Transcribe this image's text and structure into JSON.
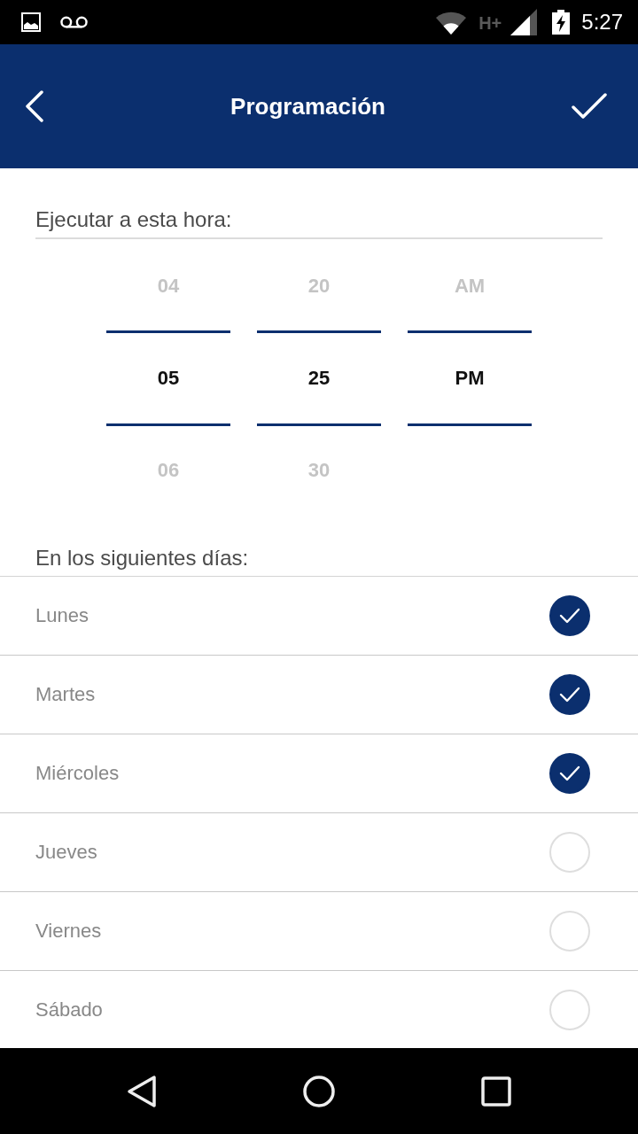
{
  "status_bar": {
    "network": "H+",
    "time": "5:27"
  },
  "app_bar": {
    "title": "Programación"
  },
  "time_section": {
    "label": "Ejecutar a esta hora:"
  },
  "picker": {
    "columns": [
      {
        "options": [
          {
            "label": "04",
            "selected": false
          },
          {
            "label": "05",
            "selected": true
          },
          {
            "label": "06",
            "selected": false
          }
        ]
      },
      {
        "options": [
          {
            "label": "20",
            "selected": false
          },
          {
            "label": "25",
            "selected": true
          },
          {
            "label": "30",
            "selected": false
          }
        ]
      },
      {
        "options": [
          {
            "label": "AM",
            "selected": false
          },
          {
            "label": "PM",
            "selected": true
          }
        ]
      }
    ]
  },
  "days_section": {
    "label": "En los siguientes días:"
  },
  "days": [
    {
      "label": "Lunes",
      "checked": true
    },
    {
      "label": "Martes",
      "checked": true
    },
    {
      "label": "Miércoles",
      "checked": true
    },
    {
      "label": "Jueves",
      "checked": false
    },
    {
      "label": "Viernes",
      "checked": false
    },
    {
      "label": "Sábado",
      "checked": false
    }
  ]
}
